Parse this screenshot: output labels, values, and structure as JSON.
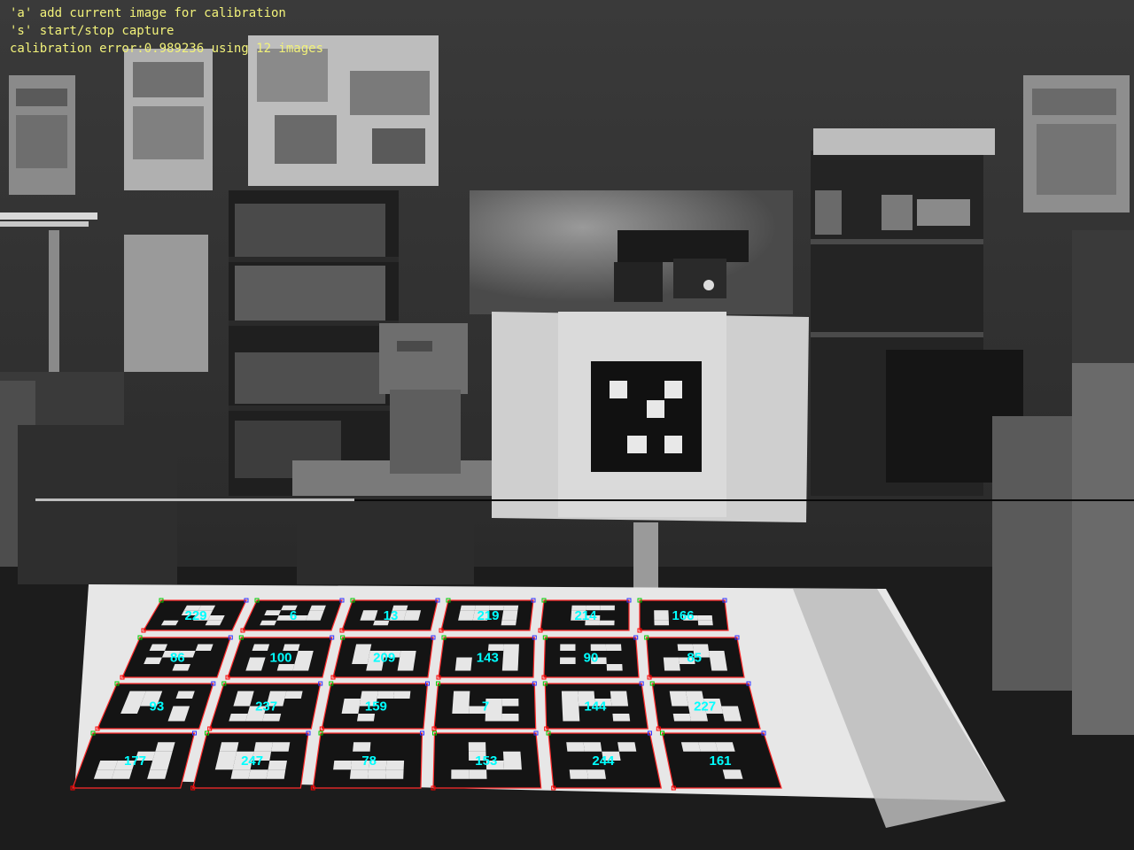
{
  "overlay": {
    "lines": [
      "'a' add current image for calibration",
      "'s' start/stop capture",
      "calibration error:0.989236 using 12 images"
    ],
    "text_color": "#f2f27a"
  },
  "markers": {
    "id_color": "#00ffff",
    "outline_color": "#ff2a2a",
    "corner_colors": [
      "#ff0000",
      "#00cc00",
      "#3333ff"
    ],
    "rows": [
      [
        "229",
        "6",
        "13",
        "219",
        "214",
        "166"
      ],
      [
        "86",
        "100",
        "209",
        "143",
        "90",
        "85"
      ],
      [
        "93",
        "237",
        "159",
        "7",
        "144",
        "227"
      ],
      [
        "177",
        "247",
        "78",
        "153",
        "244",
        "161"
      ]
    ]
  }
}
